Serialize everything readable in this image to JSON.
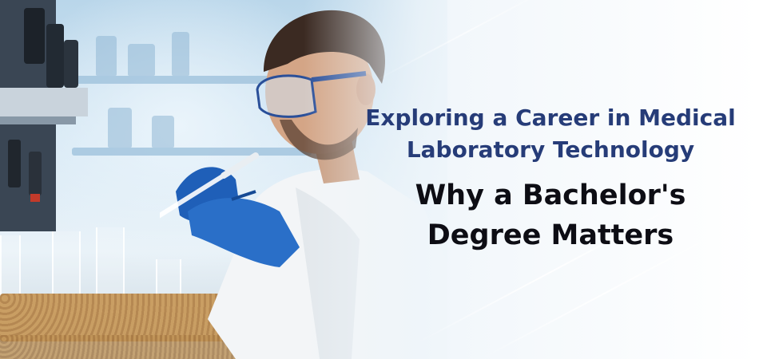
{
  "banner": {
    "title_line_1": "Exploring a Career in Medical",
    "title_line_2": "Laboratory Technology",
    "subtitle_line_1": "Why a Bachelor's",
    "subtitle_line_2": "Degree Matters"
  },
  "colors": {
    "title": "#263c78",
    "subtitle": "#0d0d14",
    "glove": "#1f5fb8",
    "coat": "#f4f6f8"
  },
  "icons": [
    "microscope-icon",
    "test-tube-icon",
    "pipette-icon"
  ]
}
